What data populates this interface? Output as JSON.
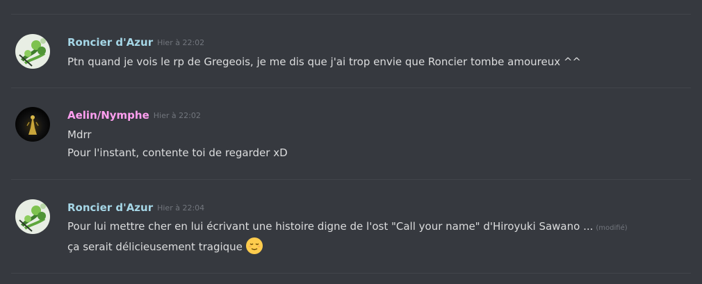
{
  "colors": {
    "background": "#36393f",
    "text": "#dcddde",
    "muted": "#72767d",
    "divider": "#42454a",
    "user_roncier": "#a5d6e6",
    "user_aelin": "#ff9ff0"
  },
  "messages": [
    {
      "author": "Roncier d'Azur",
      "timestamp": "Hier à 22:02",
      "lines": [
        "Ptn quand je vois le rp de Gregeois, je me dis que j'ai trop envie que Roncier tombe amoureux ^^"
      ],
      "avatar_icon": "green-plant-avatar"
    },
    {
      "author": "Aelin/Nymphe",
      "timestamp": "Hier à 22:02",
      "lines": [
        "Mdrr",
        "Pour l'instant, contente toi de regarder xD"
      ],
      "avatar_icon": "dark-figure-avatar"
    },
    {
      "author": "Roncier d'Azur",
      "timestamp": "Hier à 22:04",
      "lines": [
        "Pour lui mettre cher en lui écrivant une histoire digne de l'ost \"Call your name\" d'Hiroyuki Sawano ...",
        "ça serait délicieusement tragique"
      ],
      "edited_label": "(modifié)",
      "emoji": "relieved-face-emoji",
      "avatar_icon": "green-plant-avatar"
    }
  ]
}
